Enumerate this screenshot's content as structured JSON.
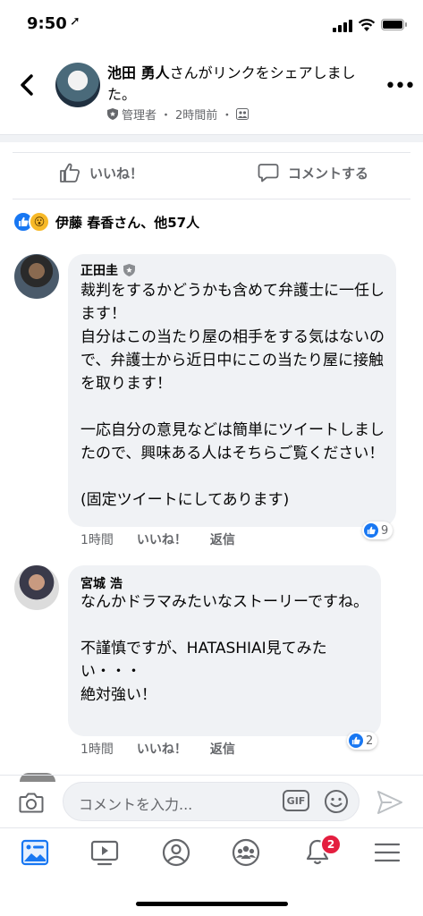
{
  "status_bar": {
    "time": "9:50",
    "location_arrow": "➚"
  },
  "header": {
    "author": "池田 勇人",
    "action": "さんがリンクをシェアしました。",
    "role": "管理者",
    "separator": "・",
    "time": "2時間前",
    "more": "•••"
  },
  "actions": {
    "like": "いいね！",
    "comment": "コメントする"
  },
  "reactions": {
    "summary": "伊藤 春香さん、他57人",
    "wow_glyph": "😮"
  },
  "comments": [
    {
      "name": "正田圭",
      "text": "裁判をするかどうかも含めて弁護士に一任します！\n自分はこの当たり屋の相手をする気はないので、弁護士から近日中にこの当たり屋に接触を取ります！\n\n一応自分の意見などは簡単にツイートしましたので、興味ある人はそちらご覧ください！\n\n(固定ツイートにしてあります)",
      "time": "1時間",
      "like": "いいね！",
      "reply": "返信",
      "reaction_count": "9"
    },
    {
      "name": "宮城 浩",
      "text": "なんかドラマみたいなストーリーですね。\n\n不謹慎ですが、HATASHIAI見てみたい・・・\n絶対強い！",
      "time": "1時間",
      "like": "いいね！",
      "reply": "返信",
      "reaction_count": "2"
    }
  ],
  "composer": {
    "placeholder": "コメントを入力...",
    "gif": "GIF"
  },
  "nav": {
    "notification_badge": "2"
  },
  "colors": {
    "accent": "#1877f2",
    "badge": "#e41e3f",
    "bubble": "#f0f2f5",
    "muted": "#65676b"
  }
}
